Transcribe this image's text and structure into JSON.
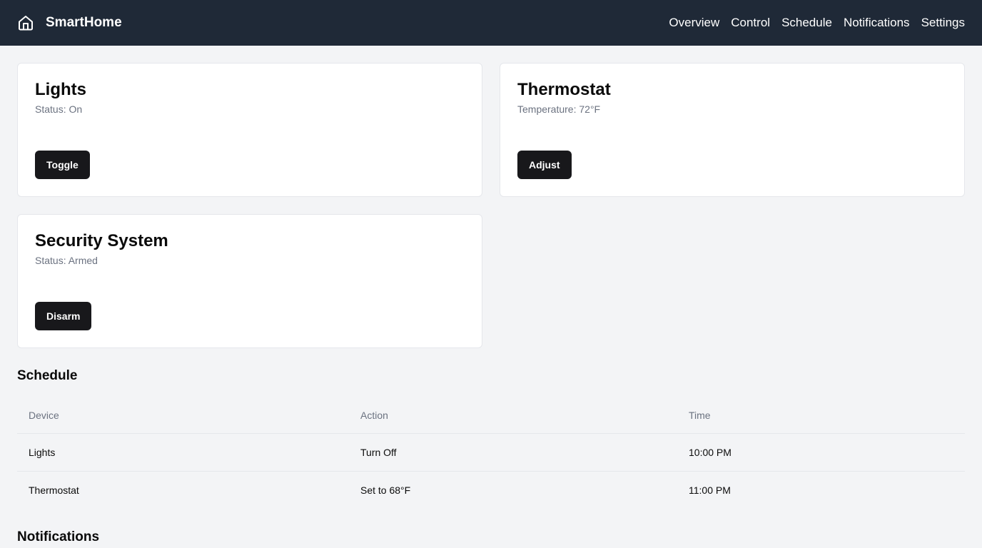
{
  "nav": {
    "brand": "SmartHome",
    "brand_icon": "home-icon",
    "links": [
      "Overview",
      "Control",
      "Schedule",
      "Notifications",
      "Settings"
    ]
  },
  "cards": [
    {
      "title": "Lights",
      "status": "Status: On",
      "button": "Toggle"
    },
    {
      "title": "Thermostat",
      "status": "Temperature: 72°F",
      "button": "Adjust"
    },
    {
      "title": "Security System",
      "status": "Status: Armed",
      "button": "Disarm"
    }
  ],
  "schedule": {
    "title": "Schedule",
    "columns": [
      "Device",
      "Action",
      "Time"
    ],
    "rows": [
      [
        "Lights",
        "Turn Off",
        "10:00 PM"
      ],
      [
        "Thermostat",
        "Set to 68°F",
        "11:00 PM"
      ]
    ]
  },
  "notifications": {
    "title": "Notifications"
  },
  "colors": {
    "navbar": "#1f2937",
    "background": "#f3f4f6",
    "button": "#18181b",
    "muted_text": "#6b7280"
  }
}
